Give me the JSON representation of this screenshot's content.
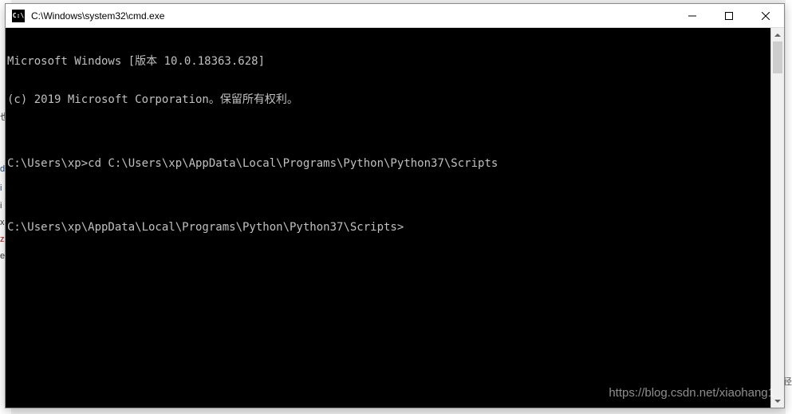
{
  "window": {
    "icon_text": "C:\\",
    "title": "C:\\Windows\\system32\\cmd.exe"
  },
  "console": {
    "lines": [
      "Microsoft Windows [版本 10.0.18363.628]",
      "(c) 2019 Microsoft Corporation。保留所有权利。",
      "",
      "C:\\Users\\xp>cd C:\\Users\\xp\\AppData\\Local\\Programs\\Python\\Python37\\Scripts",
      "",
      "C:\\Users\\xp\\AppData\\Local\\Programs\\Python\\Python37\\Scripts>"
    ]
  },
  "watermark": "https://blog.csdn.net/xiaohang1"
}
